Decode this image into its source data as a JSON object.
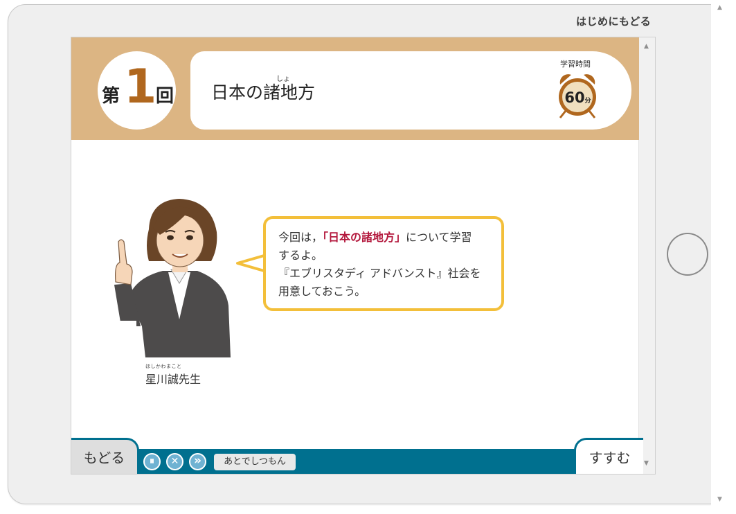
{
  "nav": {
    "back_to_start": "はじめにもどる"
  },
  "header": {
    "lesson_prefix": "第",
    "lesson_number": "1",
    "lesson_suffix": "回",
    "title": "日本の諸地方",
    "title_furigana": "しょ",
    "study_time_label": "学習時間",
    "study_time_value": "60",
    "study_time_unit": "分"
  },
  "speech": {
    "line1_pre": "今回は，",
    "line1_highlight": "「日本の諸地方」",
    "line1_post": "について学習",
    "line2": "するよ。",
    "line3": "『エブリスタディ アドバンスト』社会を",
    "line4": "用意しておこう。"
  },
  "teacher": {
    "ruby": "ほしかわまこと",
    "name": "星川誠先生"
  },
  "controls": {
    "back": "もどる",
    "next": "すすむ",
    "ask_later": "あとでしつもん",
    "pause_icon": "⏸",
    "close_icon": "✕",
    "fast_forward_icon": "»"
  },
  "colors": {
    "header": "#dcb583",
    "accent": "#00708f",
    "bubble_border": "#f3bf3a",
    "highlight": "#b3173c",
    "lesson_number": "#b0671e"
  }
}
